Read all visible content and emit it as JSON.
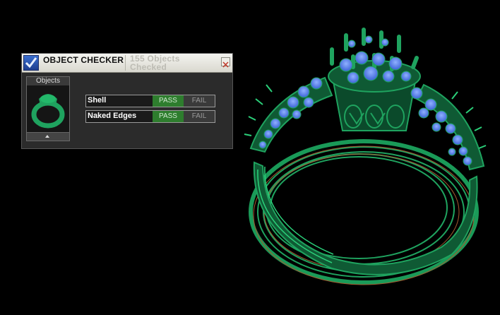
{
  "checker": {
    "title": "OBJECT CHECKER",
    "count_line1": "155 Objects",
    "count_line2": "Checked",
    "close_glyph": "✕",
    "objects_label": "Objects",
    "rows": [
      {
        "label": "Shell",
        "pass": "PASS",
        "fail": "FAIL",
        "status": "pass"
      },
      {
        "label": "Naked Edges",
        "pass": "PASS",
        "fail": "FAIL",
        "status": "pass"
      }
    ]
  },
  "colors": {
    "background": "#000000",
    "ring_wire": "#1fa35f",
    "gem": "#4c7fe8",
    "pass_active": "#2e7d2e"
  },
  "icons": {
    "title": "checkmark-icon",
    "close": "close-icon",
    "scroll": "scroll-up-icon",
    "thumbnail": "ring-thumbnail-icon"
  }
}
